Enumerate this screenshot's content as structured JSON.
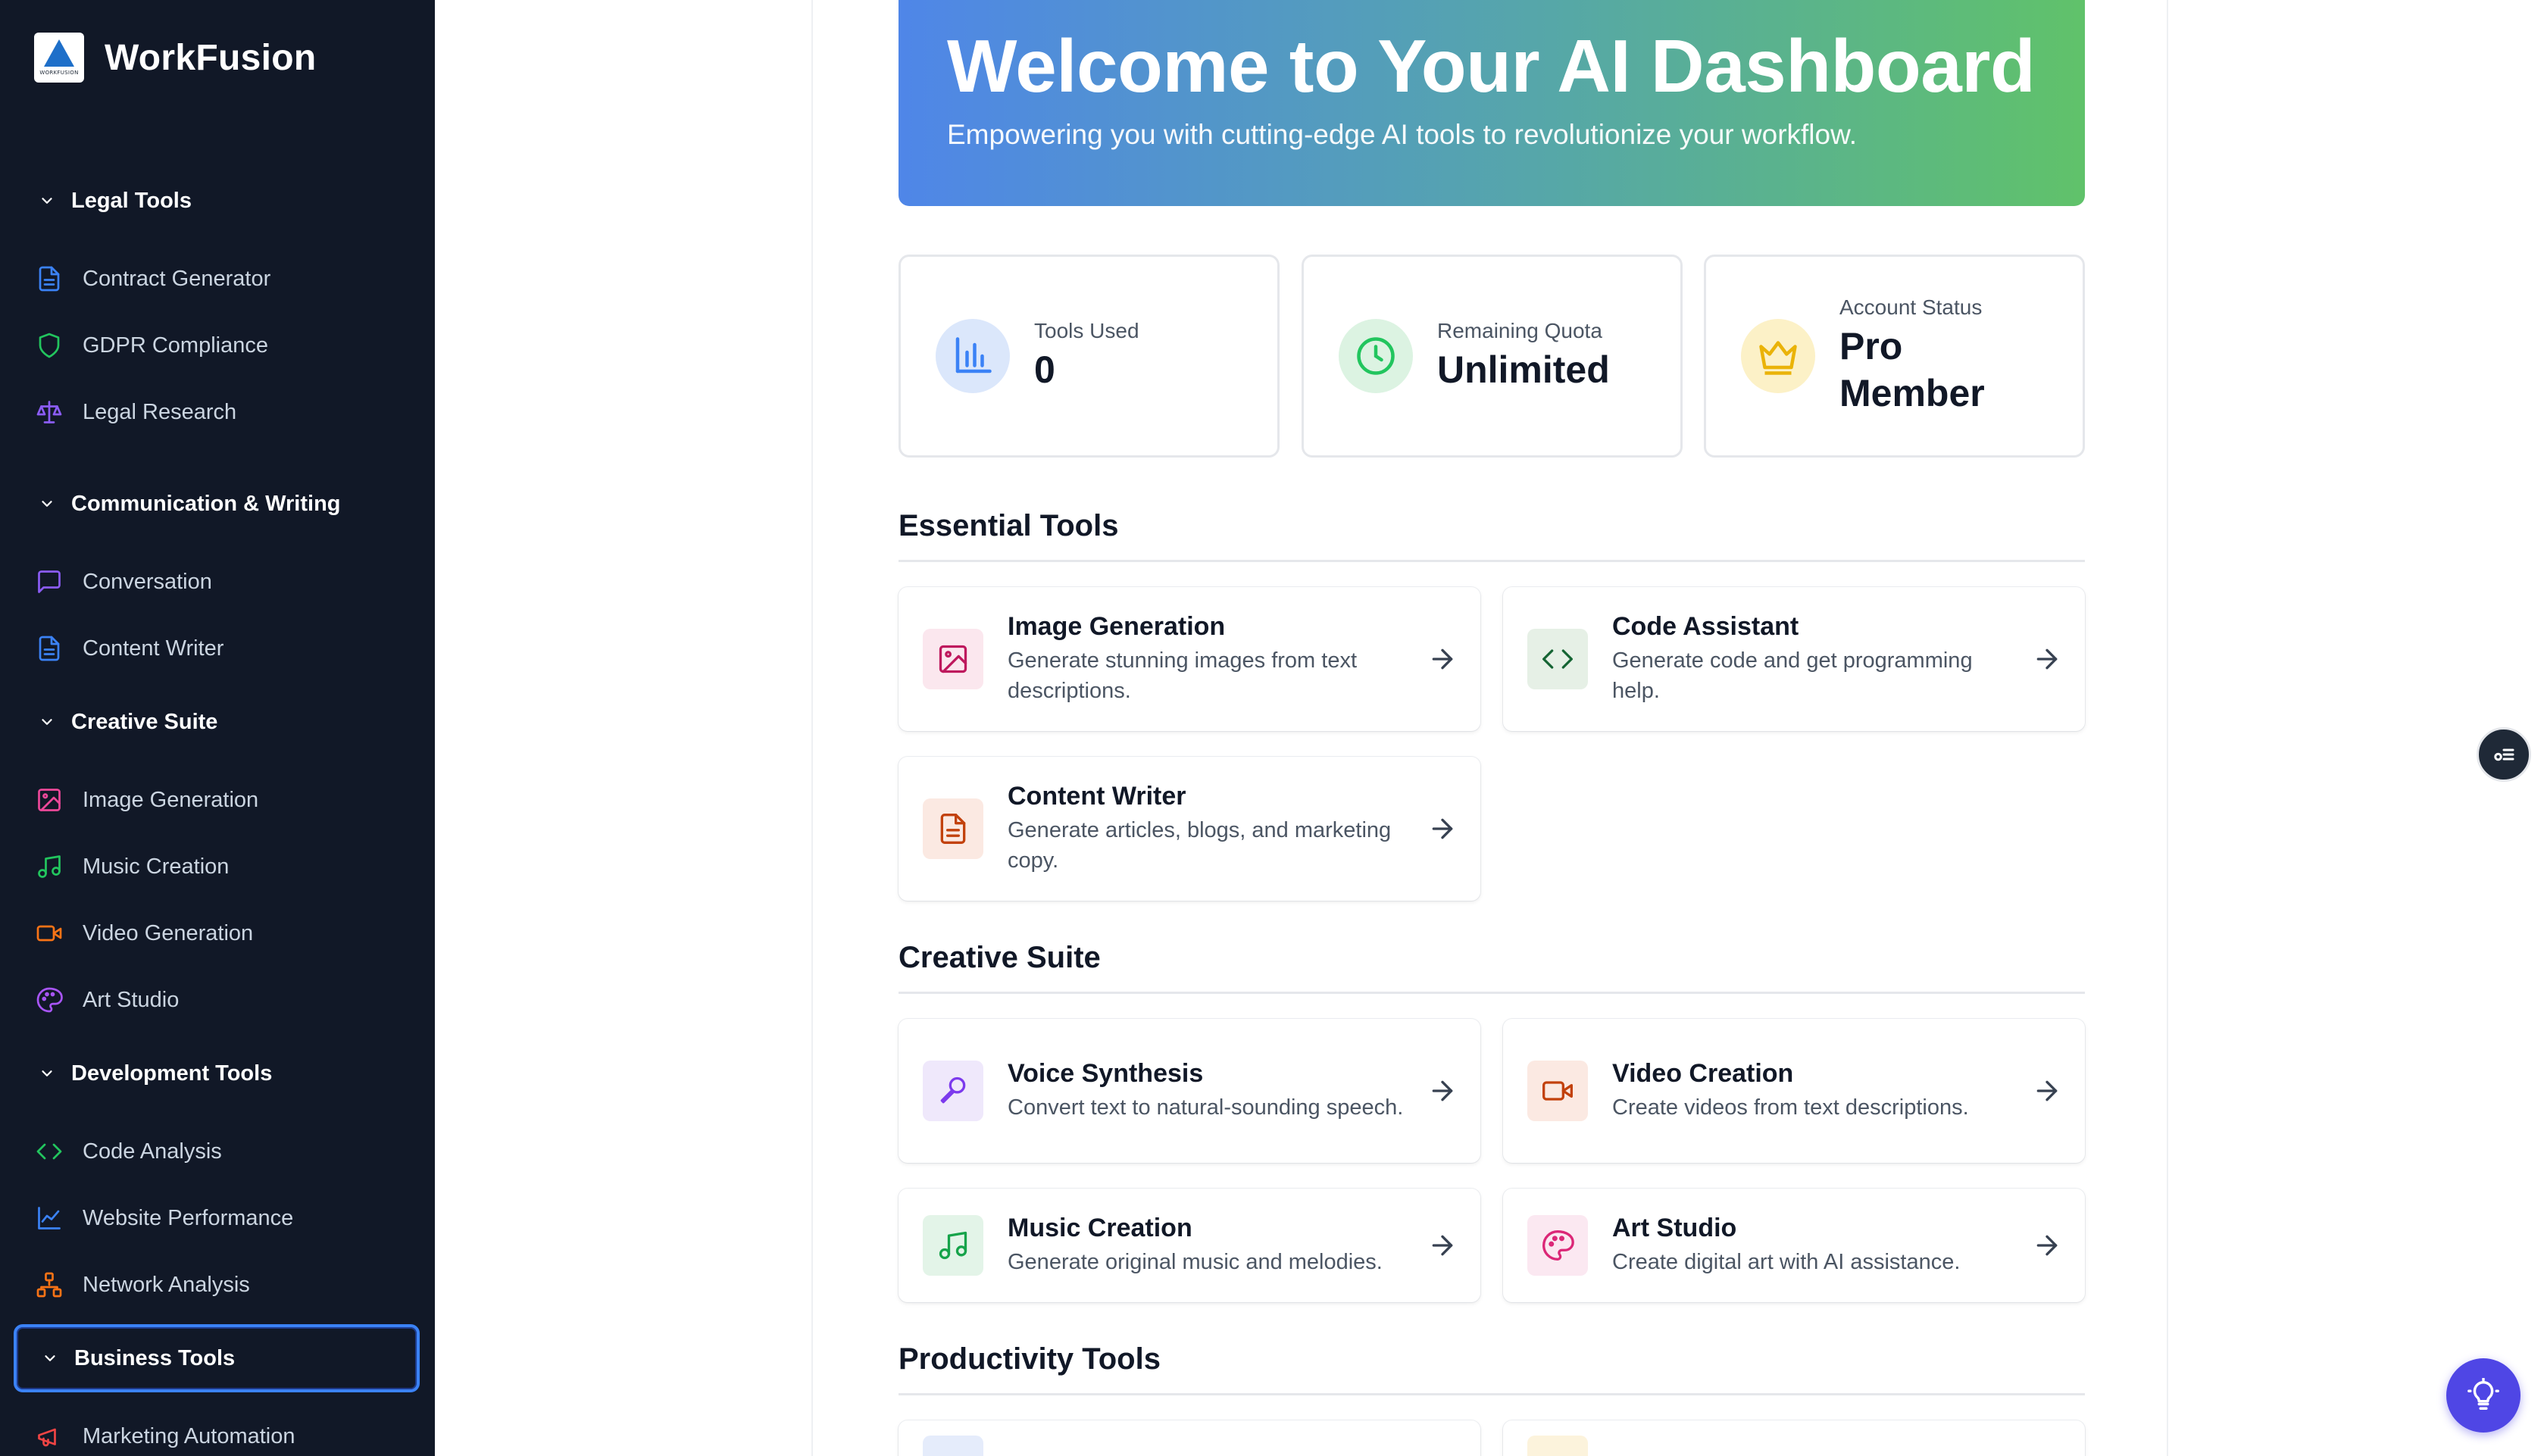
{
  "app": {
    "name": "WorkFusion",
    "logo_subtext": "WORKFUSION"
  },
  "sidebar": {
    "sections": [
      {
        "label": "Legal Tools",
        "items": [
          {
            "label": "Contract Generator",
            "icon": "document-icon",
            "color": "#3b82f6"
          },
          {
            "label": "GDPR Compliance",
            "icon": "shield-icon",
            "color": "#22c55e"
          },
          {
            "label": "Legal Research",
            "icon": "scale-icon",
            "color": "#8b5cf6"
          }
        ]
      },
      {
        "label": "Communication & Writing",
        "items": [
          {
            "label": "Conversation",
            "icon": "chat-icon",
            "color": "#8b5cf6"
          },
          {
            "label": "Content Writer",
            "icon": "document-icon",
            "color": "#3b82f6"
          }
        ]
      },
      {
        "label": "Creative Suite",
        "items": [
          {
            "label": "Image Generation",
            "icon": "image-icon",
            "color": "#ec4899"
          },
          {
            "label": "Music Creation",
            "icon": "music-icon",
            "color": "#22c55e"
          },
          {
            "label": "Video Generation",
            "icon": "video-icon",
            "color": "#f97316"
          },
          {
            "label": "Art Studio",
            "icon": "palette-icon",
            "color": "#a855f7"
          }
        ]
      },
      {
        "label": "Development Tools",
        "items": [
          {
            "label": "Code Analysis",
            "icon": "code-icon",
            "color": "#22c55e"
          },
          {
            "label": "Website Performance",
            "icon": "chart-line-icon",
            "color": "#3b82f6"
          },
          {
            "label": "Network Analysis",
            "icon": "network-icon",
            "color": "#f97316"
          }
        ]
      },
      {
        "label": "Business Tools",
        "items": [
          {
            "label": "Marketing Automation",
            "icon": "megaphone-icon",
            "color": "#ef4444"
          }
        ]
      }
    ]
  },
  "hero": {
    "title": "Welcome to Your AI Dashboard",
    "subtitle": "Empowering you with cutting-edge AI tools to revolutionize your workflow."
  },
  "stats": [
    {
      "label": "Tools Used",
      "value": "0",
      "icon": "bar-chart-icon"
    },
    {
      "label": "Remaining Quota",
      "value": "Unlimited",
      "icon": "clock-icon"
    },
    {
      "label": "Account Status",
      "value": "Pro\nMember",
      "value_line1": "Pro",
      "value_line2": "Member",
      "icon": "crown-icon"
    }
  ],
  "sections": {
    "essential": {
      "title": "Essential Tools",
      "tools": [
        {
          "name": "Image Generation",
          "desc": "Generate stunning images from text descriptions.",
          "icon": "image-icon"
        },
        {
          "name": "Code Assistant",
          "desc": "Generate code and get programming help.",
          "icon": "code-icon"
        },
        {
          "name": "Content Writer",
          "desc": "Generate articles, blogs, and marketing copy.",
          "icon": "document-icon"
        }
      ]
    },
    "creative": {
      "title": "Creative Suite",
      "tools": [
        {
          "name": "Voice Synthesis",
          "desc": "Convert text to natural-sounding speech.",
          "icon": "microphone-icon"
        },
        {
          "name": "Video Creation",
          "desc": "Create videos from text descriptions.",
          "icon": "video-icon"
        },
        {
          "name": "Music Creation",
          "desc": "Generate original music and melodies.",
          "icon": "music-icon"
        },
        {
          "name": "Art Studio",
          "desc": "Create digital art with AI assistance.",
          "icon": "palette-icon"
        }
      ]
    },
    "productivity": {
      "title": "Productivity Tools"
    }
  },
  "floating": {
    "small_button_icon": "toggle-list-icon",
    "main_button_icon": "lightbulb-icon"
  },
  "colors": {
    "sidebar_bg": "#111827",
    "accent": "#4f46e5",
    "hero_start": "#4f86e8",
    "hero_end": "#60c26a",
    "active_border": "#3b82f6"
  }
}
